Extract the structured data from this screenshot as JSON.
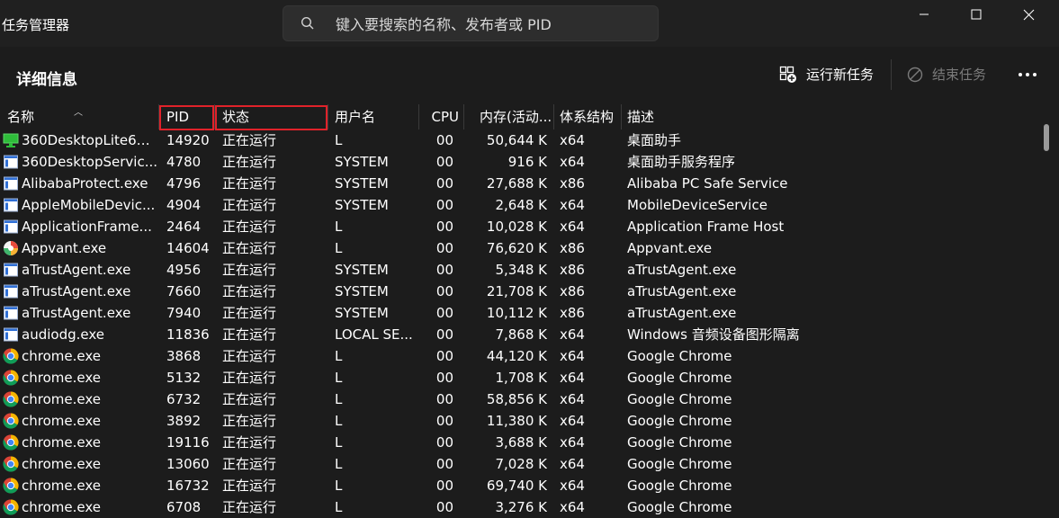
{
  "app": {
    "title": "任务管理器"
  },
  "search": {
    "placeholder": "键入要搜索的名称、发布者或 PID"
  },
  "page": {
    "title": "详细信息"
  },
  "commands": {
    "run_new_task": "运行新任务",
    "end_task": "结束任务"
  },
  "columns": {
    "name": "名称",
    "pid": "PID",
    "status": "状态",
    "user": "用户名",
    "cpu": "CPU",
    "memory": "内存(活动...",
    "arch": "体系结构",
    "desc": "描述"
  },
  "rows": [
    {
      "name": "360DesktopLite64....",
      "pid": "14920",
      "status": "正在运行",
      "user": "L",
      "cpu": "00",
      "mem": "50,644 K",
      "arch": "x64",
      "desc": "桌面助手",
      "icon": "monitor-icon"
    },
    {
      "name": "360DesktopServic...",
      "pid": "4780",
      "status": "正在运行",
      "user": "SYSTEM",
      "cpu": "00",
      "mem": "916 K",
      "arch": "x64",
      "desc": "桌面助手服务程序",
      "icon": "app-window-icon"
    },
    {
      "name": "AlibabaProtect.exe",
      "pid": "4796",
      "status": "正在运行",
      "user": "SYSTEM",
      "cpu": "00",
      "mem": "27,688 K",
      "arch": "x86",
      "desc": "Alibaba PC Safe Service",
      "icon": "app-window-icon"
    },
    {
      "name": "AppleMobileDevic...",
      "pid": "4904",
      "status": "正在运行",
      "user": "SYSTEM",
      "cpu": "00",
      "mem": "2,648 K",
      "arch": "x64",
      "desc": "MobileDeviceService",
      "icon": "app-window-icon"
    },
    {
      "name": "ApplicationFrame...",
      "pid": "2464",
      "status": "正在运行",
      "user": "L",
      "cpu": "00",
      "mem": "10,028 K",
      "arch": "x64",
      "desc": "Application Frame Host",
      "icon": "app-window-icon"
    },
    {
      "name": "Appvant.exe",
      "pid": "14604",
      "status": "正在运行",
      "user": "L",
      "cpu": "00",
      "mem": "76,620 K",
      "arch": "x86",
      "desc": "Appvant.exe",
      "icon": "appvant-icon"
    },
    {
      "name": "aTrustAgent.exe",
      "pid": "4956",
      "status": "正在运行",
      "user": "SYSTEM",
      "cpu": "00",
      "mem": "5,348 K",
      "arch": "x86",
      "desc": "aTrustAgent.exe",
      "icon": "app-window-icon"
    },
    {
      "name": "aTrustAgent.exe",
      "pid": "7660",
      "status": "正在运行",
      "user": "SYSTEM",
      "cpu": "00",
      "mem": "21,708 K",
      "arch": "x86",
      "desc": "aTrustAgent.exe",
      "icon": "app-window-icon"
    },
    {
      "name": "aTrustAgent.exe",
      "pid": "7940",
      "status": "正在运行",
      "user": "SYSTEM",
      "cpu": "00",
      "mem": "10,112 K",
      "arch": "x86",
      "desc": "aTrustAgent.exe",
      "icon": "app-window-icon"
    },
    {
      "name": "audiodg.exe",
      "pid": "11836",
      "status": "正在运行",
      "user": "LOCAL SE...",
      "cpu": "00",
      "mem": "7,868 K",
      "arch": "x64",
      "desc": "Windows 音频设备图形隔离",
      "icon": "app-window-icon"
    },
    {
      "name": "chrome.exe",
      "pid": "3868",
      "status": "正在运行",
      "user": "L",
      "cpu": "00",
      "mem": "44,120 K",
      "arch": "x64",
      "desc": "Google Chrome",
      "icon": "chrome-icon"
    },
    {
      "name": "chrome.exe",
      "pid": "5132",
      "status": "正在运行",
      "user": "L",
      "cpu": "00",
      "mem": "1,708 K",
      "arch": "x64",
      "desc": "Google Chrome",
      "icon": "chrome-icon"
    },
    {
      "name": "chrome.exe",
      "pid": "6732",
      "status": "正在运行",
      "user": "L",
      "cpu": "00",
      "mem": "58,856 K",
      "arch": "x64",
      "desc": "Google Chrome",
      "icon": "chrome-icon"
    },
    {
      "name": "chrome.exe",
      "pid": "3892",
      "status": "正在运行",
      "user": "L",
      "cpu": "00",
      "mem": "11,380 K",
      "arch": "x64",
      "desc": "Google Chrome",
      "icon": "chrome-icon"
    },
    {
      "name": "chrome.exe",
      "pid": "19116",
      "status": "正在运行",
      "user": "L",
      "cpu": "00",
      "mem": "3,688 K",
      "arch": "x64",
      "desc": "Google Chrome",
      "icon": "chrome-icon"
    },
    {
      "name": "chrome.exe",
      "pid": "13060",
      "status": "正在运行",
      "user": "L",
      "cpu": "00",
      "mem": "7,028 K",
      "arch": "x64",
      "desc": "Google Chrome",
      "icon": "chrome-icon"
    },
    {
      "name": "chrome.exe",
      "pid": "16732",
      "status": "正在运行",
      "user": "L",
      "cpu": "00",
      "mem": "69,740 K",
      "arch": "x64",
      "desc": "Google Chrome",
      "icon": "chrome-icon"
    },
    {
      "name": "chrome.exe",
      "pid": "6708",
      "status": "正在运行",
      "user": "L",
      "cpu": "00",
      "mem": "3,276 K",
      "arch": "x64",
      "desc": "Google Chrome",
      "icon": "chrome-icon"
    }
  ],
  "colors": {
    "background": "#1c1c1c",
    "titlebar": "#202020",
    "highlight": "#e0222a",
    "text": "#ffffff"
  }
}
